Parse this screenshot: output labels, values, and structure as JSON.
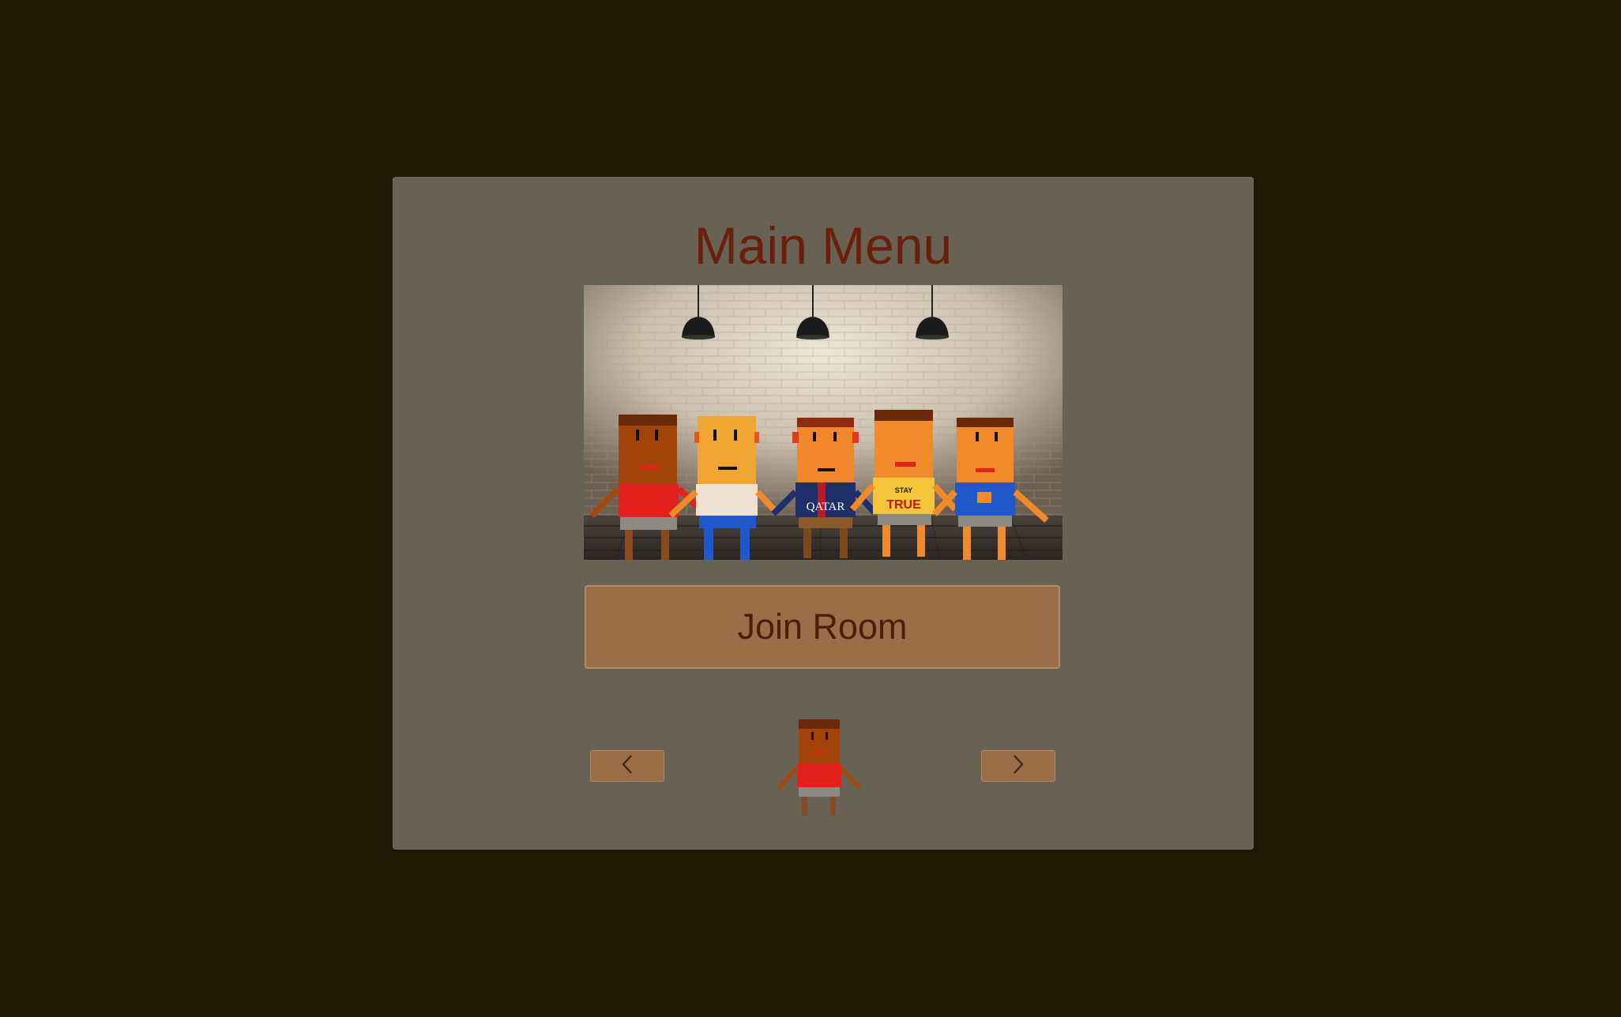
{
  "menu": {
    "title": "Main Menu",
    "join_label": "Join Room",
    "prev_icon": "chevron-left-icon",
    "next_icon": "chevron-right-icon"
  },
  "hero": {
    "shirt_texts": [
      "QATAR",
      "STAY",
      "TRUE"
    ]
  },
  "colors": {
    "background": "#201704",
    "panel": "#676254",
    "title": "#6b1f0a",
    "button": "#9c6e48",
    "button_text": "#4a200c"
  }
}
